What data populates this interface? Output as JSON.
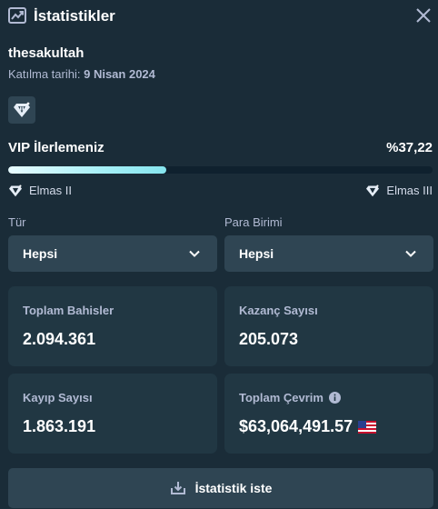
{
  "header": {
    "title": "İstatistikler"
  },
  "user": {
    "name": "thesakultah",
    "join_label": "Katılma tarihi:",
    "join_date": "9 Nisan 2024"
  },
  "vip": {
    "label": "VIP İlerlemeniz",
    "percent_text": "%37,22",
    "progress": 0.3722,
    "current_tier": "Elmas II",
    "next_tier": "Elmas III",
    "bar_color": "#a6f0f7"
  },
  "filters": {
    "type": {
      "label": "Tür",
      "value": "Hepsi"
    },
    "currency": {
      "label": "Para Birimi",
      "value": "Hepsi"
    }
  },
  "stats": {
    "total_bets": {
      "label": "Toplam Bahisler",
      "value": "2.094.361"
    },
    "wins": {
      "label": "Kazanç Sayısı",
      "value": "205.073"
    },
    "losses": {
      "label": "Kayıp Sayısı",
      "value": "1.863.191"
    },
    "wagered": {
      "label": "Toplam Çevrim",
      "value": "$63,064,491.57"
    }
  },
  "cta": {
    "label": "İstatistik iste"
  },
  "icons": {
    "header": "trending-up-icon",
    "close": "close-icon",
    "badge": "diamond-icon",
    "chevron": "chevron-down-icon",
    "info": "info-icon",
    "flag": "us-flag-icon",
    "download": "download-icon"
  },
  "colors": {
    "background": "#1a2c38",
    "card": "#213743",
    "control": "#2f4553",
    "muted_text": "#b1bad3"
  }
}
